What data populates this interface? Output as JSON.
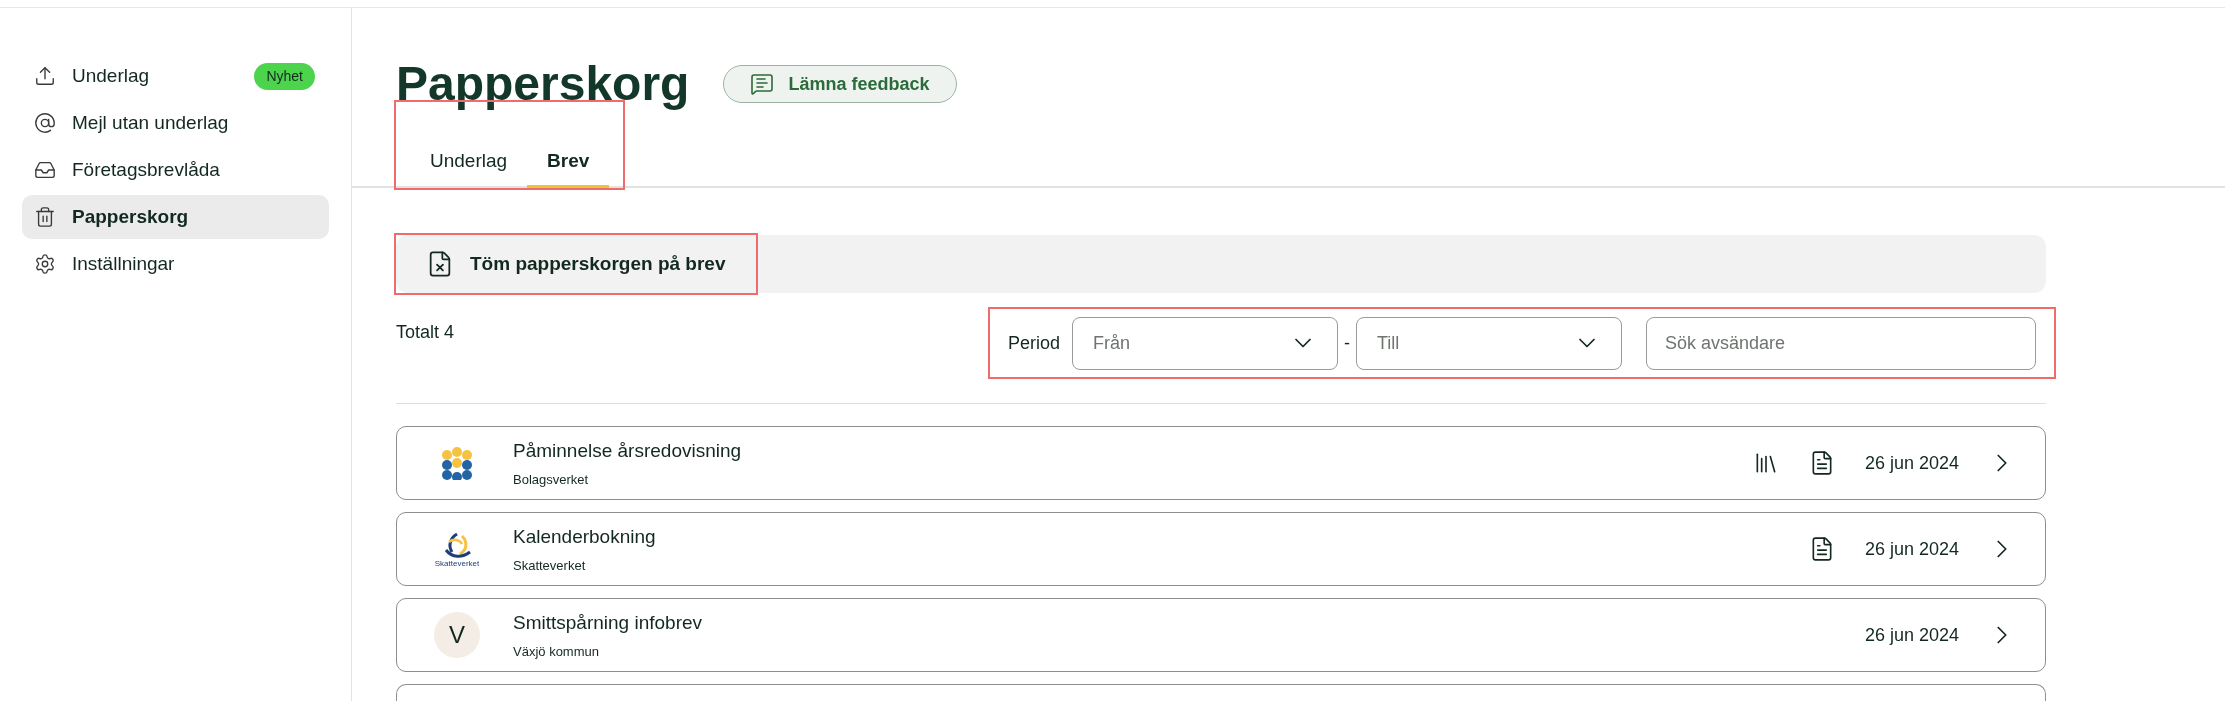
{
  "sidebar": {
    "items": [
      {
        "kind": "upload",
        "label": "Underlag",
        "badge": "Nyhet",
        "selected": false
      },
      {
        "kind": "at",
        "label": "Mejl utan underlag",
        "selected": false
      },
      {
        "kind": "inbox",
        "label": "Företagsbrevlåda",
        "selected": false
      },
      {
        "kind": "trash",
        "label": "Papperskorg",
        "selected": true
      },
      {
        "kind": "settings",
        "label": "Inställningar",
        "selected": false
      }
    ]
  },
  "page": {
    "title": "Papperskorg",
    "feedback_button": "Lämna feedback"
  },
  "tabs": {
    "highlighted": true,
    "items": [
      {
        "label": "Underlag",
        "selected": false
      },
      {
        "label": "Brev",
        "selected": true
      }
    ]
  },
  "toolbar": {
    "empty_button": "Töm papperskorgen på brev",
    "highlighted": true
  },
  "total": "Totalt 4",
  "filters": {
    "highlighted": true,
    "period_label": "Period",
    "from": {
      "placeholder": "Från"
    },
    "separator": "-",
    "to": {
      "placeholder": "Till"
    },
    "search": {
      "placeholder": "Sök avsändare"
    }
  },
  "letters": [
    {
      "kind": "dots-logo",
      "title": "Påminnelse årsredovisning",
      "sender": "Bolagsverket",
      "archive": true,
      "document": true,
      "date": "26 jun 2024"
    },
    {
      "kind": "swirl-logo",
      "logo_text": "Skatteverket",
      "title": "Kalenderbokning",
      "sender": "Skatteverket",
      "archive": false,
      "document": true,
      "date": "26 jun 2024"
    },
    {
      "kind": "letter",
      "letter": "V",
      "title": "Smittspårning infobrev",
      "sender": "Växjö kommun",
      "archive": false,
      "document": false,
      "date": "26 jun 2024"
    }
  ]
}
